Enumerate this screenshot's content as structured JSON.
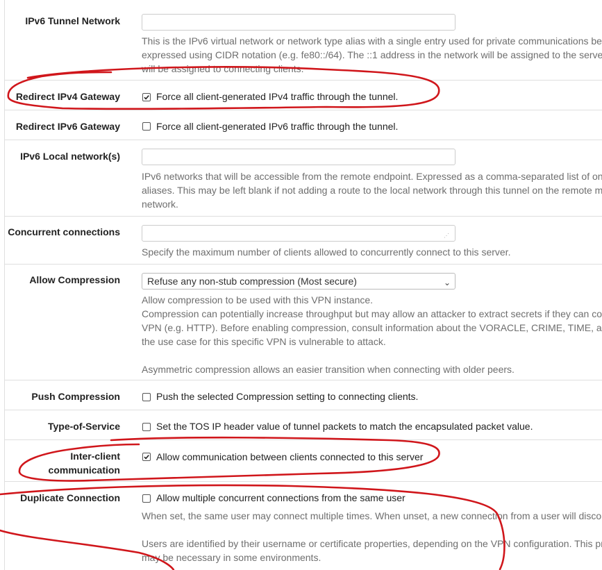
{
  "rows": {
    "ipv6_tunnel_network": {
      "label": "IPv6 Tunnel Network",
      "value": "",
      "help_lines": [
        "This is the IPv6 virtual network or network type alias with a single entry used for private communications between",
        "expressed using CIDR notation (e.g. fe80::/64). The ::1 address in the network will be assigned to the server",
        "will be assigned to connecting clients."
      ]
    },
    "redirect_ipv4": {
      "label": "Redirect IPv4 Gateway",
      "checked": true,
      "text": "Force all client-generated IPv4 traffic through the tunnel."
    },
    "redirect_ipv6": {
      "label": "Redirect IPv6 Gateway",
      "checked": false,
      "text": "Force all client-generated IPv6 traffic through the tunnel."
    },
    "ipv6_local_networks": {
      "label": "IPv6 Local network(s)",
      "value": "",
      "help_lines": [
        "IPv6 networks that will be accessible from the remote endpoint. Expressed as a comma-separated list of one",
        "aliases. This may be left blank if not adding a route to the local network through this tunnel on the remote m",
        "network."
      ]
    },
    "concurrent_connections": {
      "label": "Concurrent connections",
      "value": "",
      "help": "Specify the maximum number of clients allowed to concurrently connect to this server."
    },
    "allow_compression": {
      "label": "Allow Compression",
      "selected": "Refuse any non-stub compression (Most secure)",
      "help_lines": [
        "Allow compression to be used with this VPN instance.",
        "Compression can potentially increase throughput but may allow an attacker to extract secrets if they can co",
        "VPN (e.g. HTTP). Before enabling compression, consult information about the VORACLE, CRIME, TIME, and",
        "the use case for this specific VPN is vulnerable to attack.",
        "",
        "Asymmetric compression allows an easier transition when connecting with older peers."
      ]
    },
    "push_compression": {
      "label": "Push Compression",
      "checked": false,
      "text": "Push the selected Compression setting to connecting clients."
    },
    "type_of_service": {
      "label": "Type-of-Service",
      "checked": false,
      "text": "Set the TOS IP header value of tunnel packets to match the encapsulated packet value."
    },
    "inter_client": {
      "label_line1": "Inter-client",
      "label_line2": "communication",
      "checked": true,
      "text": "Allow communication between clients connected to this server"
    },
    "duplicate_connection": {
      "label": "Duplicate Connection",
      "checked": false,
      "text": "Allow multiple concurrent connections from the same user",
      "help_lines": [
        "When set, the same user may connect multiple times. When unset, a new connection from a user will disco",
        "",
        "Users are identified by their username or certificate properties, depending on the VPN configuration. This pr",
        "may be necessary in some environments."
      ]
    }
  },
  "colors": {
    "annotation_red": "#d0161b",
    "border": "#dfdfdf",
    "help_text": "#6e6e6e"
  },
  "icons": {
    "checkbox_checked": "check-icon",
    "select_caret": "chevron-down-icon",
    "resize_grip": "resize-grip-icon"
  }
}
